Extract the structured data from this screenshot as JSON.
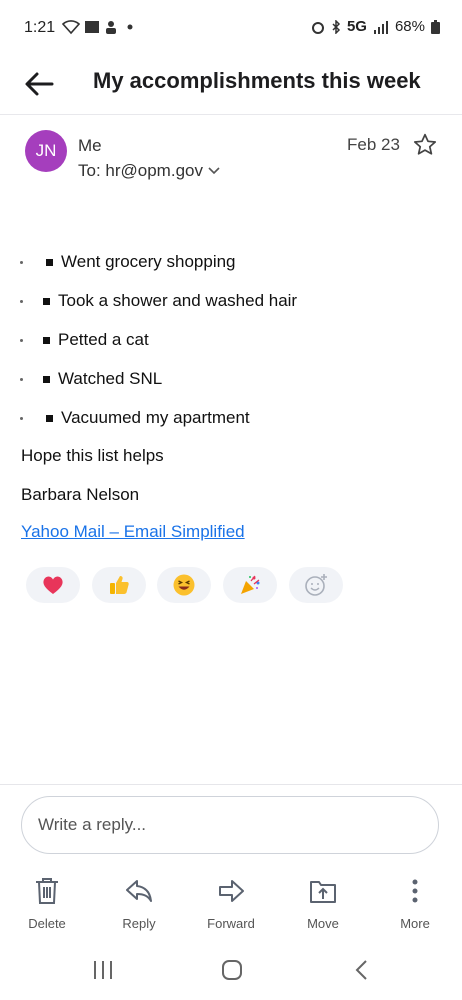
{
  "status_bar": {
    "time": "1:21",
    "network": "5G",
    "battery": "68%"
  },
  "header": {
    "title": "My accomplishments this week",
    "back_icon": "arrow-left-icon"
  },
  "message": {
    "avatar_initials": "JN",
    "avatar_color": "#a53ebd",
    "sender": "Me",
    "to": "To: hr@opm.gov",
    "date": "Feb 23",
    "list_items": [
      "Went grocery shopping",
      "Took a shower and washed hair",
      "Petted a cat",
      "Watched SNL",
      "Vacuumed my apartment"
    ],
    "closing": "Hope this list helps",
    "signature": "Barbara Nelson",
    "footer_link": "Yahoo Mail – Email Simplified"
  },
  "reactions": [
    "heart",
    "thumbs-up",
    "laughing",
    "party-popper",
    "add-reaction"
  ],
  "reply": {
    "placeholder": "Write a reply..."
  },
  "toolbar": {
    "delete": "Delete",
    "reply": "Reply",
    "forward": "Forward",
    "move": "Move",
    "more": "More"
  },
  "accent_color": "#1a73e8"
}
